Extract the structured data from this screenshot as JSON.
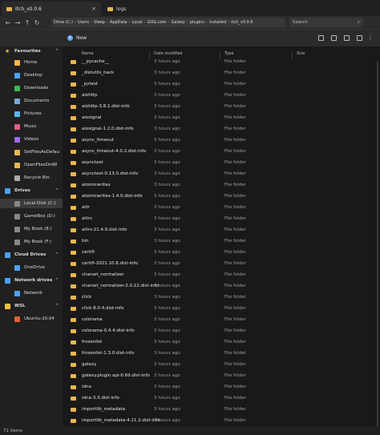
{
  "tabs": [
    {
      "label": "itch_v0.0.6",
      "active": true
    },
    {
      "label": "logs",
      "active": false
    }
  ],
  "address": {
    "crumbs": [
      "Drive (C:)",
      "Users",
      "Sleep",
      "AppData",
      "Local",
      "GOG.com",
      "Galaxy",
      "plugins",
      "installed",
      "itch_v0.0.6"
    ],
    "search_placeholder": "Search"
  },
  "toolbar": {
    "new_label": "New"
  },
  "sidebar": {
    "items": [
      {
        "label": "Favourites",
        "section": true,
        "icon": "star-icon",
        "color": "#f0c040"
      },
      {
        "label": "Home",
        "icon": "home-icon",
        "color": "#ffb74a"
      },
      {
        "label": "Desktop",
        "icon": "desktop-icon",
        "color": "#4aa3ff"
      },
      {
        "label": "Downloads",
        "icon": "downloads-icon",
        "color": "#3fb950"
      },
      {
        "label": "Documents",
        "icon": "documents-icon",
        "color": "#7aa7d8"
      },
      {
        "label": "Pictures",
        "icon": "pictures-icon",
        "color": "#5bb8e8"
      },
      {
        "label": "Music",
        "icon": "music-icon",
        "color": "#e05b8f"
      },
      {
        "label": "Videos",
        "icon": "videos-icon",
        "color": "#9c6cf0"
      },
      {
        "label": "SetFilesAsDefau",
        "icon": "folder-icon",
        "color": "#e8b74e"
      },
      {
        "label": "OpenFilesOnWi",
        "icon": "folder-icon",
        "color": "#e8b74e"
      },
      {
        "label": "Recycle Bin",
        "icon": "recycle-bin-icon",
        "color": "#aaaaaa"
      },
      {
        "label": "Drives",
        "section": true,
        "icon": "drives-icon",
        "color": "#4aa3ff"
      },
      {
        "label": "Local Disk (C:)",
        "icon": "drive-icon",
        "color": "#888888",
        "selected": true
      },
      {
        "label": "GameBox (D:)",
        "icon": "drive-icon",
        "color": "#888888"
      },
      {
        "label": "My Book (E:)",
        "icon": "drive-icon",
        "color": "#888888"
      },
      {
        "label": "My Book (F:)",
        "icon": "drive-icon",
        "color": "#888888"
      },
      {
        "label": "Cloud Drives",
        "section": true,
        "icon": "cloud-icon",
        "color": "#4aa3ff"
      },
      {
        "label": "OneDrive",
        "icon": "onedrive-icon",
        "color": "#4aa3ff"
      },
      {
        "label": "Network drives",
        "section": true,
        "icon": "network-icon",
        "color": "#4aa3ff"
      },
      {
        "label": "Network",
        "icon": "network-icon",
        "color": "#4aa3ff"
      },
      {
        "label": "WSL",
        "section": true,
        "icon": "linux-icon",
        "color": "#f0c040"
      },
      {
        "label": "Ubuntu-20.04",
        "icon": "ubuntu-icon",
        "color": "#e06030"
      }
    ]
  },
  "columns": [
    "Name",
    "Date modified",
    "Type",
    "Size"
  ],
  "files": [
    {
      "name": "__pycache__",
      "date": "3 hours ago",
      "type": "File folder"
    },
    {
      "name": "_distutils_hack",
      "date": "3 hours ago",
      "type": "File folder"
    },
    {
      "name": "_pytest",
      "date": "3 hours ago",
      "type": "File folder"
    },
    {
      "name": "aiohttp",
      "date": "3 hours ago",
      "type": "File folder"
    },
    {
      "name": "aiohttp-3.8.1.dist-info",
      "date": "3 hours ago",
      "type": "File folder"
    },
    {
      "name": "aiosignal",
      "date": "3 hours ago",
      "type": "File folder"
    },
    {
      "name": "aiosignal-1.2.0.dist-info",
      "date": "3 hours ago",
      "type": "File folder"
    },
    {
      "name": "async_timeout",
      "date": "3 hours ago",
      "type": "File folder"
    },
    {
      "name": "async_timeout-4.0.2.dist-info",
      "date": "3 hours ago",
      "type": "File folder"
    },
    {
      "name": "asynctest",
      "date": "3 hours ago",
      "type": "File folder"
    },
    {
      "name": "asynctest-0.13.0.dist-info",
      "date": "3 hours ago",
      "type": "File folder"
    },
    {
      "name": "atomicwrites",
      "date": "3 hours ago",
      "type": "File folder"
    },
    {
      "name": "atomicwrites-1.4.0.dist-info",
      "date": "3 hours ago",
      "type": "File folder"
    },
    {
      "name": "attr",
      "date": "3 hours ago",
      "type": "File folder"
    },
    {
      "name": "attrs",
      "date": "3 hours ago",
      "type": "File folder"
    },
    {
      "name": "attrs-21.4.0.dist-info",
      "date": "3 hours ago",
      "type": "File folder"
    },
    {
      "name": "bin",
      "date": "3 hours ago",
      "type": "File folder"
    },
    {
      "name": "certifi",
      "date": "3 hours ago",
      "type": "File folder"
    },
    {
      "name": "certifi-2021.10.8.dist-info",
      "date": "3 hours ago",
      "type": "File folder"
    },
    {
      "name": "charset_normalizer",
      "date": "3 hours ago",
      "type": "File folder"
    },
    {
      "name": "charset_normalizer-2.0.12.dist-info",
      "date": "3 hours ago",
      "type": "File folder"
    },
    {
      "name": "click",
      "date": "3 hours ago",
      "type": "File folder"
    },
    {
      "name": "click-8.0.4.dist-info",
      "date": "3 hours ago",
      "type": "File folder"
    },
    {
      "name": "colorama",
      "date": "3 hours ago",
      "type": "File folder"
    },
    {
      "name": "colorama-0.4.4.dist-info",
      "date": "3 hours ago",
      "type": "File folder"
    },
    {
      "name": "frozenlist",
      "date": "3 hours ago",
      "type": "File folder"
    },
    {
      "name": "frozenlist-1.3.0.dist-info",
      "date": "3 hours ago",
      "type": "File folder"
    },
    {
      "name": "galaxy",
      "date": "3 hours ago",
      "type": "File folder"
    },
    {
      "name": "galaxy.plugin.api-0.69.dist-info",
      "date": "3 hours ago",
      "type": "File folder"
    },
    {
      "name": "idna",
      "date": "3 hours ago",
      "type": "File folder"
    },
    {
      "name": "idna-3.3.dist-info",
      "date": "3 hours ago",
      "type": "File folder"
    },
    {
      "name": "importlib_metadata",
      "date": "3 hours ago",
      "type": "File folder"
    },
    {
      "name": "importlib_metadata-4.11.2.dist-info",
      "date": "3 hours ago",
      "type": "File folder"
    }
  ],
  "status": {
    "item_count": "71 items"
  }
}
